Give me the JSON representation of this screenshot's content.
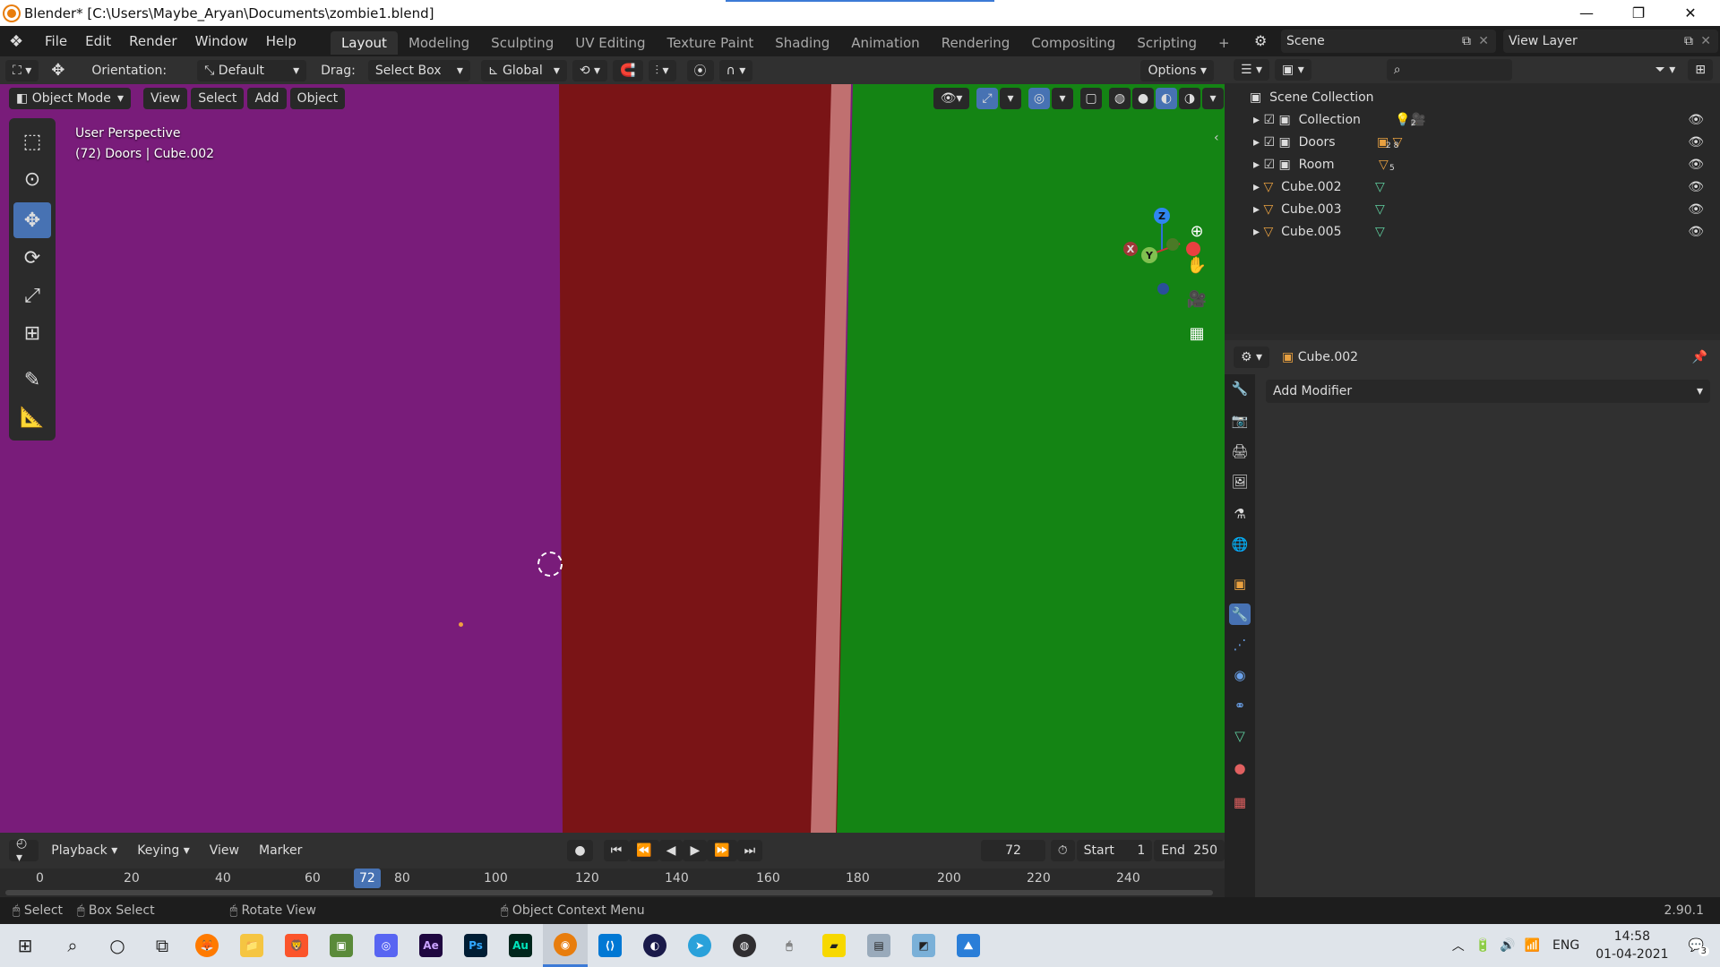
{
  "titlebar": {
    "title": "Blender* [C:\\Users\\Maybe_Aryan\\Documents\\zombie1.blend]",
    "minimize": "—",
    "maximize": "❐",
    "close": "✕"
  },
  "menu": [
    "File",
    "Edit",
    "Render",
    "Window",
    "Help"
  ],
  "workspaces": [
    "Layout",
    "Modeling",
    "Sculpting",
    "UV Editing",
    "Texture Paint",
    "Shading",
    "Animation",
    "Rendering",
    "Compositing",
    "Scripting"
  ],
  "active_workspace": "Layout",
  "add_workspace": "+",
  "scene": "Scene",
  "view_layer": "View Layer",
  "viewport_header": {
    "orientation_label": "Orientation:",
    "orientation_value": "Default",
    "drag_label": "Drag:",
    "drag_value": "Select Box",
    "transform_space": "Global",
    "options": "Options"
  },
  "viewport_menu": {
    "mode": "Object Mode",
    "view": "View",
    "select": "Select",
    "add": "Add",
    "object": "Object"
  },
  "viewport_info": {
    "line1": "User Perspective",
    "line2": "(72) Doors | Cube.002"
  },
  "gizmo": {
    "z": "Z",
    "y": "Y",
    "x": "X"
  },
  "tools": [
    "select-box",
    "cursor",
    "move",
    "rotate",
    "scale",
    "transform",
    "annotate",
    "measure"
  ],
  "timeline": {
    "menus": [
      "Playback",
      "Keying",
      "View",
      "Marker"
    ],
    "current_frame": "72",
    "start_label": "Start",
    "start": "1",
    "end_label": "End",
    "end": "250",
    "ticks": [
      "0",
      "20",
      "40",
      "60",
      "80",
      "100",
      "120",
      "140",
      "160",
      "180",
      "200",
      "220",
      "240"
    ]
  },
  "statusbar": {
    "select": "Select",
    "box_select": "Box Select",
    "rotate_view": "Rotate View",
    "context_menu": "Object Context Menu",
    "version": "2.90.1"
  },
  "outliner": {
    "root": "Scene Collection",
    "rows": [
      {
        "name": "Collection",
        "badge": "2"
      },
      {
        "name": "Doors",
        "badge": "2 8"
      },
      {
        "name": "Room",
        "badge": "5"
      },
      {
        "name": "Cube.002",
        "badge": ""
      },
      {
        "name": "Cube.003",
        "badge": ""
      },
      {
        "name": "Cube.005",
        "badge": ""
      }
    ]
  },
  "properties": {
    "object_name": "Cube.002",
    "add_modifier": "Add Modifier"
  },
  "taskbar": {
    "time": "14:58",
    "date": "01-04-2021",
    "lang": "ENG",
    "notifications": "3"
  }
}
